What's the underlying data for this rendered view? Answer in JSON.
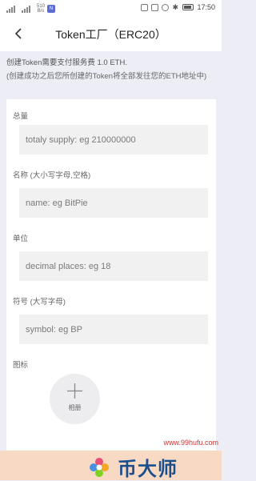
{
  "status_bar": {
    "carrier_left": "",
    "speed": "510\nB/s",
    "nfc": "N",
    "time": "17:50"
  },
  "header": {
    "title": "Token工厂（ERC20）"
  },
  "notice": {
    "line1": "创建Token需要支付服务费 1.0 ETH.",
    "line2": "(创建成功之后您所创建的Token将全部发往您的ETH地址中)"
  },
  "form": {
    "supply_label": "总量",
    "supply_placeholder": "totaly supply: eg 210000000",
    "name_label": "名称 (大小写字母,空格)",
    "name_placeholder": "name: eg BitPie",
    "unit_label": "单位",
    "unit_placeholder": "decimal places: eg 18",
    "symbol_label": "符号 (大写字母)",
    "symbol_placeholder": "symbol: eg BP",
    "icon_label": "图标",
    "upload_label": "相册"
  },
  "watermark": {
    "brand": "币大师",
    "url": "www.99hufu.com"
  },
  "colors": {
    "page_bg": "#ecedf5",
    "card_bg": "#ffffff",
    "field_bg": "#f1f1f2",
    "banner_bg": "#f7d9c4",
    "brand": "#1b4f8c"
  }
}
